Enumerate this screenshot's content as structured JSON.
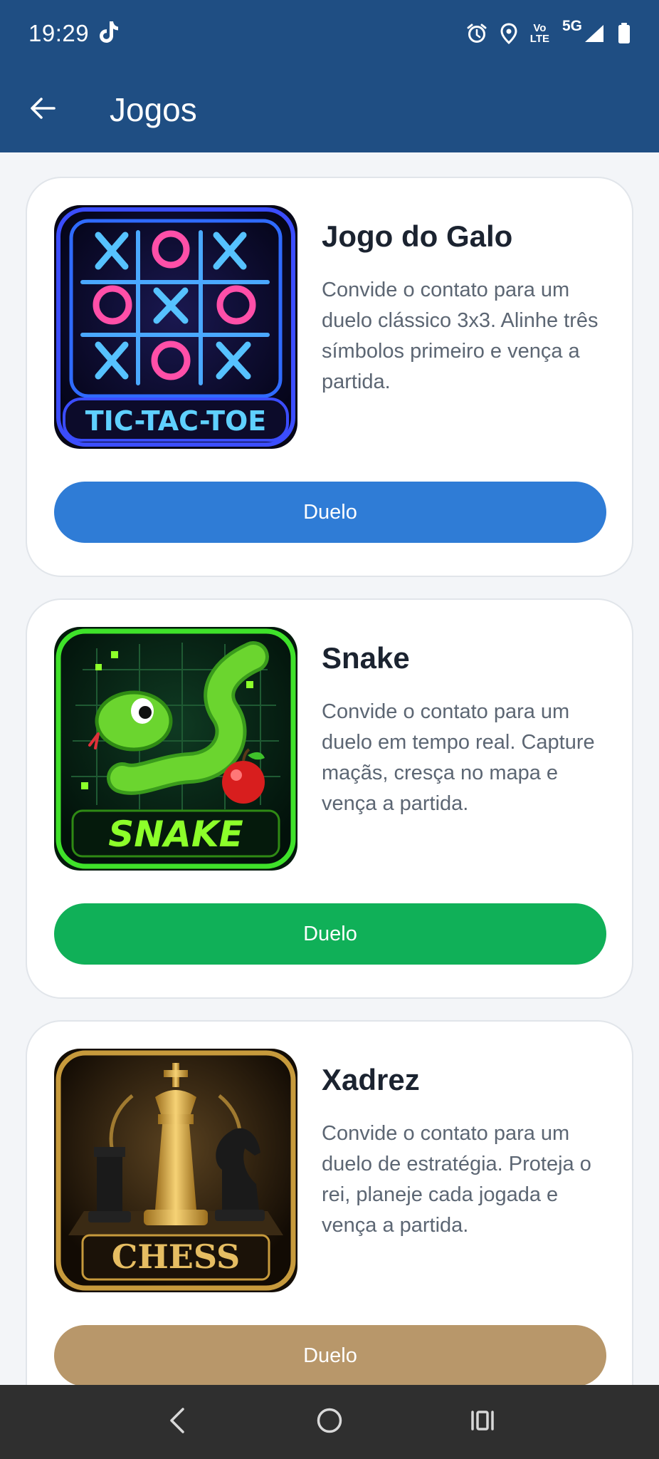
{
  "status": {
    "time": "19:29",
    "volte_line1": "Vo",
    "volte_line2": "LTE",
    "network": "5G"
  },
  "header": {
    "title": "Jogos"
  },
  "games": [
    {
      "title": "Jogo do Galo",
      "description": "Convide o contato para um duelo clássico 3x3. Alinhe três símbolos primeiro e vença a partida.",
      "button": "Duelo",
      "button_color": "#2f7cd6",
      "image_text": "TIC-TAC-TOE"
    },
    {
      "title": "Snake",
      "description": "Convide o contato para um duelo em tempo real. Capture maçãs, cresça no mapa e vença a partida.",
      "button": "Duelo",
      "button_color": "#10b058",
      "image_text": "SNAKE"
    },
    {
      "title": "Xadrez",
      "description": "Convide o contato para um duelo de estratégia. Proteja o rei, planeje cada jogada e vença a partida.",
      "button": "Duelo",
      "button_color": "#b8976a",
      "image_text": "CHESS"
    }
  ],
  "icons": {
    "back": "arrow-left-icon",
    "tiktok": "tiktok-icon",
    "alarm": "alarm-icon",
    "location": "location-pin-icon",
    "signal": "signal-icon",
    "battery": "battery-icon",
    "nav_back": "nav-back-icon",
    "nav_home": "nav-home-icon",
    "nav_recents": "nav-recents-icon"
  }
}
